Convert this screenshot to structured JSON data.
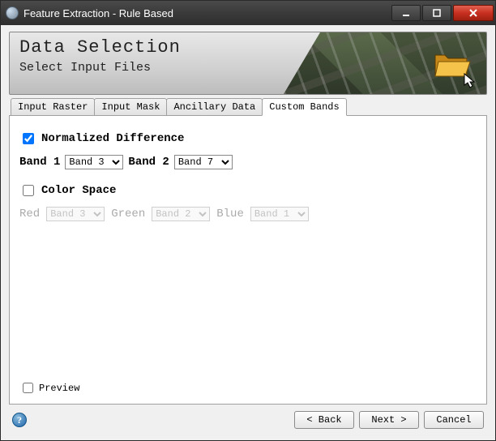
{
  "window": {
    "title": "Feature Extraction - Rule Based"
  },
  "header": {
    "title": "Data Selection",
    "subtitle": "Select Input Files"
  },
  "tabs": [
    {
      "label": "Input Raster"
    },
    {
      "label": "Input Mask"
    },
    {
      "label": "Ancillary Data"
    },
    {
      "label": "Custom Bands"
    }
  ],
  "panel": {
    "normalized_diff": {
      "label": "Normalized Difference",
      "checked": true,
      "band1_label": "Band 1",
      "band1_value": "Band 3",
      "band2_label": "Band 2",
      "band2_value": "Band 7"
    },
    "color_space": {
      "label": "Color Space",
      "checked": false,
      "red_label": "Red",
      "red_value": "Band 3",
      "green_label": "Green",
      "green_value": "Band 2",
      "blue_label": "Blue",
      "blue_value": "Band 1"
    },
    "preview": {
      "label": "Preview",
      "checked": false
    }
  },
  "footer": {
    "back": "< Back",
    "next": "Next >",
    "cancel": "Cancel"
  }
}
